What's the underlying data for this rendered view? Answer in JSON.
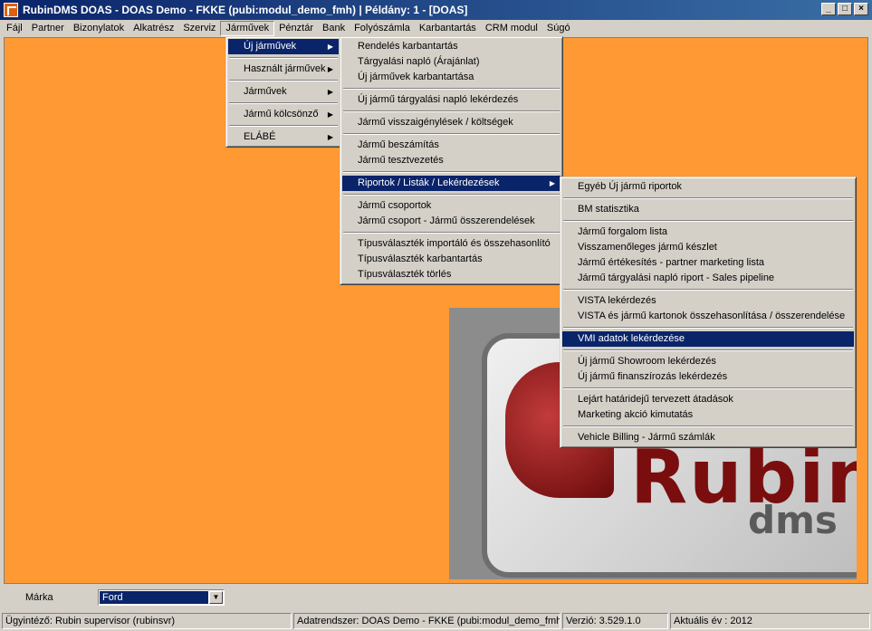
{
  "window": {
    "title": "RubinDMS DOAS - DOAS Demo - FKKE (pubi:modul_demo_fmh) | Példány: 1 - [DOAS]"
  },
  "menubar": [
    "Fájl",
    "Partner",
    "Bizonylatok",
    "Alkatrész",
    "Szerviz",
    "Járművek",
    "Pénztár",
    "Bank",
    "Folyószámla",
    "Karbantartás",
    "CRM modul",
    "Súgó"
  ],
  "menu1": [
    "Új járművek",
    "Használt járművek",
    "Járművek",
    "Jármű kölcsönző",
    "ELÁBÉ"
  ],
  "menu2": {
    "g1": [
      "Rendelés karbantartás",
      "Tárgyalási napló (Árajánlat)",
      "Új járművek karbantartása"
    ],
    "g2": [
      "Új jármű tárgyalási napló lekérdezés"
    ],
    "g3": [
      "Jármű visszaigénylések / költségek"
    ],
    "g4": [
      "Jármű beszámítás",
      "Jármű tesztvezetés"
    ],
    "g5": [
      "Riportok / Listák / Lekérdezések"
    ],
    "g6": [
      "Jármű csoportok",
      "Jármű csoport - Jármű összerendelések"
    ],
    "g7": [
      "Típusválaszték importáló és összehasonlító",
      "Típusválaszték karbantartás",
      "Típusválaszték törlés"
    ]
  },
  "menu3": {
    "g1": [
      "Egyéb Új jármű riportok"
    ],
    "g2": [
      "BM statisztika"
    ],
    "g3": [
      "Jármű forgalom lista",
      "Visszamenőleges jármű készlet",
      "Jármű értékesítés - partner marketing lista",
      "Jármű tárgyalási napló riport - Sales pipeline"
    ],
    "g4": [
      "VISTA lekérdezés",
      "VISTA és jármű kartonok összehasonlítása / összerendelése"
    ],
    "g5": [
      "VMI adatok lekérdezése"
    ],
    "g6": [
      "Új jármű Showroom lekérdezés",
      "Új jármű finanszírozás lekérdezés"
    ],
    "g7": [
      "Lejárt határidejű tervezett átadások",
      "Marketing akció kimutatás"
    ],
    "g8": [
      "Vehicle Billing - Jármű számlák"
    ]
  },
  "logo": {
    "main": "Rubin",
    "sub": "dms"
  },
  "bottom": {
    "marka_label": "Márka",
    "marka_value": "Ford"
  },
  "status": {
    "user": "Ügyintéző: Rubin supervisor (rubinsvr)",
    "db": "Adatrendszer: DOAS Demo - FKKE (pubi:modul_demo_fmh)",
    "version": "Verzió: 3.529.1.0",
    "year": "Aktuális év : 2012"
  }
}
